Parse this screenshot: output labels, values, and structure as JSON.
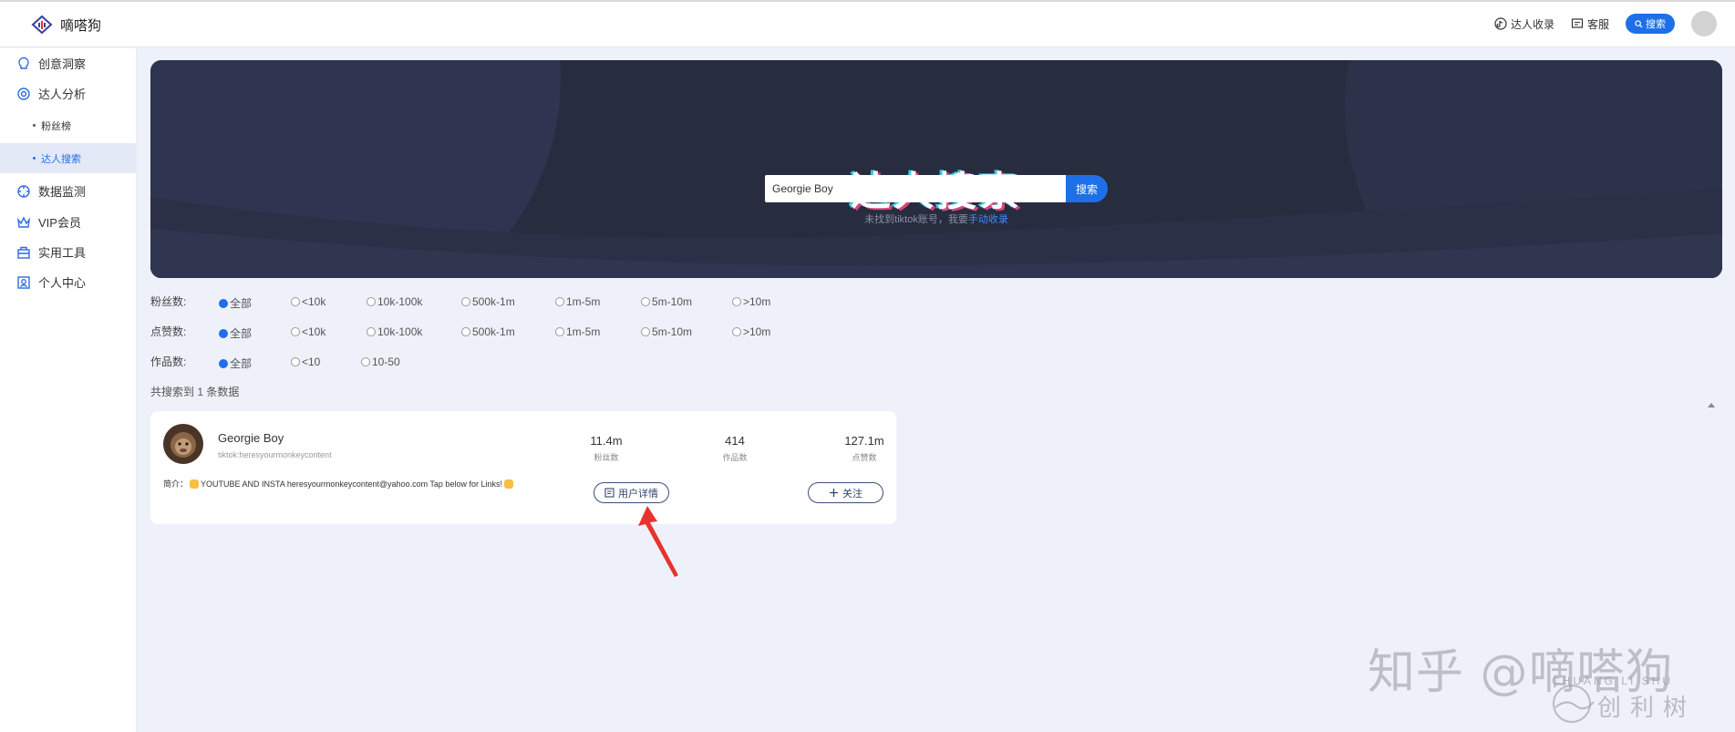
{
  "app": {
    "name": "嘀嗒狗"
  },
  "header": {
    "links": [
      {
        "label": "达人收录",
        "icon": "tiktok-icon"
      },
      {
        "label": "客服",
        "icon": "chat-icon"
      }
    ],
    "search_button": "搜索"
  },
  "sidebar": {
    "items": [
      {
        "label": "创意洞察",
        "icon": "lightbulb-icon"
      },
      {
        "label": "达人分析",
        "icon": "gear-icon"
      },
      {
        "label": "粉丝榜",
        "sub": true
      },
      {
        "label": "达人搜索",
        "sub": true,
        "active": true
      },
      {
        "label": "数据监测",
        "icon": "monitor-icon"
      },
      {
        "label": "VIP会员",
        "icon": "crown-icon"
      },
      {
        "label": "实用工具",
        "icon": "toolbox-icon"
      },
      {
        "label": "个人中心",
        "icon": "user-icon"
      }
    ]
  },
  "banner": {
    "title": "达人搜索",
    "search_value": "Georgie Boy",
    "search_button": "搜索",
    "hint_prefix": "未找到tiktok账号，我要",
    "hint_link": "手动收录"
  },
  "filters": [
    {
      "label": "粉丝数:",
      "options": [
        "全部",
        "<10k",
        "10k-100k",
        "500k-1m",
        "1m-5m",
        "5m-10m",
        ">10m"
      ],
      "selected": 0
    },
    {
      "label": "点赞数:",
      "options": [
        "全部",
        "<10k",
        "10k-100k",
        "500k-1m",
        "1m-5m",
        "5m-10m",
        ">10m"
      ],
      "selected": 0
    },
    {
      "label": "作品数:",
      "options": [
        "全部",
        "<10",
        "10-50"
      ],
      "selected": 0
    }
  ],
  "result_count": "共搜索到 1 条数据",
  "result": {
    "name": "Georgie Boy",
    "handle": "tiktok:heresyourmonkeycontent",
    "bio_prefix": "简介：",
    "bio_text": "YOUTUBE AND INSTA heresyourmonkeycontent@yahoo.com Tap below for Links!",
    "stats": [
      {
        "value": "11.4m",
        "label": "粉丝数"
      },
      {
        "value": "414",
        "label": "作品数"
      },
      {
        "value": "127.1m",
        "label": "点赞数"
      }
    ],
    "detail_button": "用户详情",
    "follow_button": "关注"
  },
  "watermark": {
    "text": "知乎 @嘀嗒狗",
    "brand_en": "CHUANG LI SHU",
    "brand_cn": "创利树"
  },
  "colors": {
    "accent": "#1f6fe8",
    "banner_bg": "#272c3f",
    "page_bg": "#eef1f9",
    "annotation_arrow": "#e8322e"
  }
}
